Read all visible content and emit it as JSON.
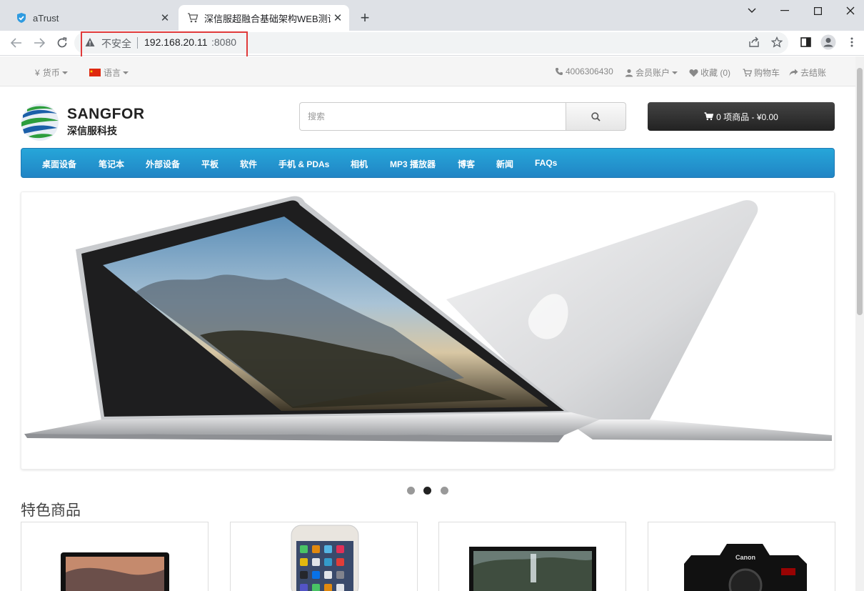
{
  "browser": {
    "tabs": [
      {
        "title": "aTrust",
        "active": false
      },
      {
        "title": "深信服超融合基础架构WEB测试",
        "active": true
      }
    ],
    "address": {
      "security_label": "不安全",
      "host": "192.168.20.11",
      "port": ":8080"
    }
  },
  "topbar": {
    "currency_label": "货币",
    "language_label": "语言",
    "phone": "4006306430",
    "account_label": "会员账户",
    "wishlist_label": "收藏 (0)",
    "cart_label": "购物车",
    "checkout_label": "去结账"
  },
  "header": {
    "logo_text": "SANGFOR",
    "logo_sub": "深信服科技",
    "search_placeholder": "搜索",
    "cart_button_label": "0 项商品 - ¥0.00"
  },
  "menu": {
    "items": [
      "桌面设备",
      "笔记本",
      "外部设备",
      "平板",
      "软件",
      "手机 & PDAs",
      "相机",
      "MP3 播放器",
      "博客",
      "新闻",
      "FAQs"
    ]
  },
  "slideshow": {
    "slide_count": 3,
    "active_index": 1
  },
  "featured": {
    "title": "特色商品",
    "products": [
      {
        "image": "macbook-image"
      },
      {
        "image": "iphone-image"
      },
      {
        "image": "apple-cinema-display-image"
      },
      {
        "image": "canon-camera-image"
      }
    ]
  },
  "colors": {
    "menu_blue": "#229ac8",
    "cart_dark": "#333333",
    "highlight_red": "#e03a3a"
  }
}
